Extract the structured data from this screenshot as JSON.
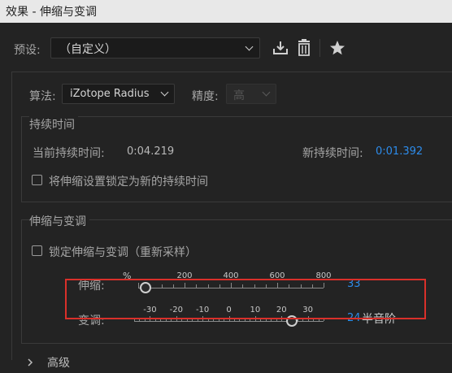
{
  "window": {
    "title": "效果 - 伸缩与变调"
  },
  "preset": {
    "label": "预设:",
    "value": "（自定义）"
  },
  "toolbar": {
    "save_icon": "download-icon",
    "delete_icon": "trash-icon",
    "favorite_icon": "star-icon"
  },
  "algorithm": {
    "label": "算法:",
    "value": "iZotope Radius"
  },
  "precision": {
    "label": "精度:",
    "value": "高"
  },
  "duration": {
    "section_title": "持续时间",
    "current_label": "当前持续时间:",
    "current_value": "0:04.219",
    "new_label": "新持续时间:",
    "new_value": "0:01.392",
    "lock_label": "将伸缩设置锁定为新的持续时间",
    "lock_checked": false
  },
  "stretch_pitch": {
    "section_title": "伸缩与变调",
    "lock_label": "锁定伸缩与变调（重新采样）",
    "lock_checked": false,
    "stretch": {
      "label": "伸缩:",
      "unit": "%",
      "ticks": [
        "200",
        "400",
        "600",
        "800"
      ],
      "value": "33",
      "numeric": 33
    },
    "pitch": {
      "label": "变调:",
      "ticks": [
        "-30",
        "-20",
        "-10",
        "0",
        "10",
        "20",
        "30"
      ],
      "value": "24",
      "unit": "半音阶",
      "numeric": 24
    }
  },
  "advanced": {
    "label": "高级"
  },
  "colors": {
    "accent": "#2d8ceb",
    "highlight": "#d9302a"
  }
}
